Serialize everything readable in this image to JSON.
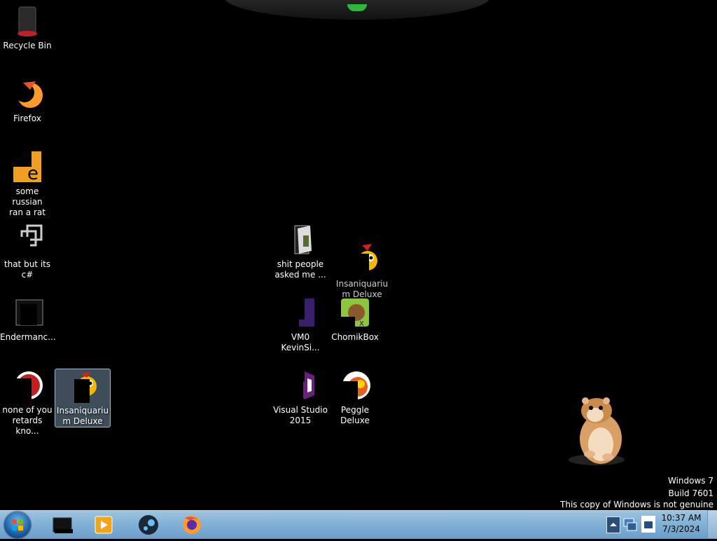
{
  "desktop": {
    "icons": [
      {
        "label": "Recycle Bin",
        "icon": "recycle-bin-icon"
      },
      {
        "label": "Firefox",
        "icon": "firefox-icon"
      },
      {
        "label": "some russian\nran a rat",
        "icon": "file-icon"
      },
      {
        "label": "that but its c#",
        "icon": "shortcut-icon"
      },
      {
        "label": "Endermanc...",
        "icon": "app-icon"
      },
      {
        "label": "none of you\nretards kno...",
        "icon": "app-icon"
      },
      {
        "label": "Insaniquariu\nm Deluxe",
        "icon": "fish-icon"
      },
      {
        "label": "shit people\nasked me ...",
        "icon": "folder-icon"
      },
      {
        "label": "Insaniquariu\nm Deluxe",
        "icon": "fish-icon"
      },
      {
        "label": "VM0\nKevinSi...",
        "icon": "app-icon"
      },
      {
        "label": "ChomikBox",
        "icon": "chomikbox-icon"
      },
      {
        "label": "Visual Studio\n2015",
        "icon": "visual-studio-icon"
      },
      {
        "label": "Peggle Deluxe",
        "icon": "peggle-icon"
      }
    ]
  },
  "watermark": {
    "line1": "Windows 7",
    "line2": "Build 7601",
    "line3": "This copy of Windows is not genuine"
  },
  "taskbar": {
    "pinned": [
      "terminal-icon",
      "media-player-icon",
      "steam-icon",
      "firefox-icon"
    ]
  },
  "clock": {
    "time": "10:37 AM",
    "date": "7/3/2024"
  },
  "colors": {
    "desktop_background": "#000000",
    "taskbar": "#8ab8db",
    "selection": "#8caac8"
  }
}
